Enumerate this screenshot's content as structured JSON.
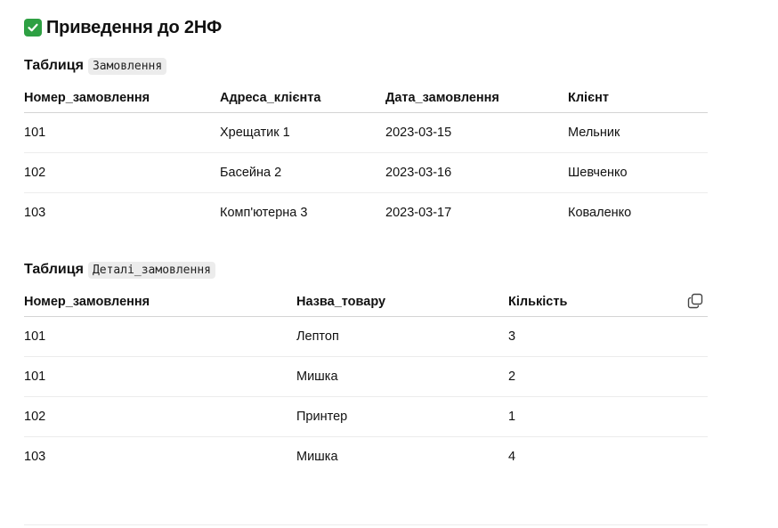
{
  "heading": {
    "icon": "check-mark-button-icon",
    "text": "Приведення до 2НФ"
  },
  "table1": {
    "caption_prefix": "Таблиця",
    "caption_code": "Замовлення",
    "headers": [
      "Номер_замовлення",
      "Адреса_клієнта",
      "Дата_замовлення",
      "Клієнт"
    ],
    "rows": [
      [
        "101",
        "Хрещатик 1",
        "2023-03-15",
        "Мельник"
      ],
      [
        "102",
        "Басейна 2",
        "2023-03-16",
        "Шевченко"
      ],
      [
        "103",
        "Комп'ютерна 3",
        "2023-03-17",
        "Коваленко"
      ]
    ]
  },
  "table2": {
    "caption_prefix": "Таблиця",
    "caption_code": "Деталі_замовлення",
    "headers": [
      "Номер_замовлення",
      "Назва_товару",
      "Кількість"
    ],
    "rows": [
      [
        "101",
        "Лептоп",
        "3"
      ],
      [
        "101",
        "Мишка",
        "2"
      ],
      [
        "102",
        "Принтер",
        "1"
      ],
      [
        "103",
        "Мишка",
        "4"
      ]
    ],
    "copy_icon": "copy-icon"
  },
  "colors": {
    "check_green": "#2ea043",
    "header_border": "#d4d4d4",
    "row_border": "#ececec",
    "code_bg": "#ececec"
  }
}
